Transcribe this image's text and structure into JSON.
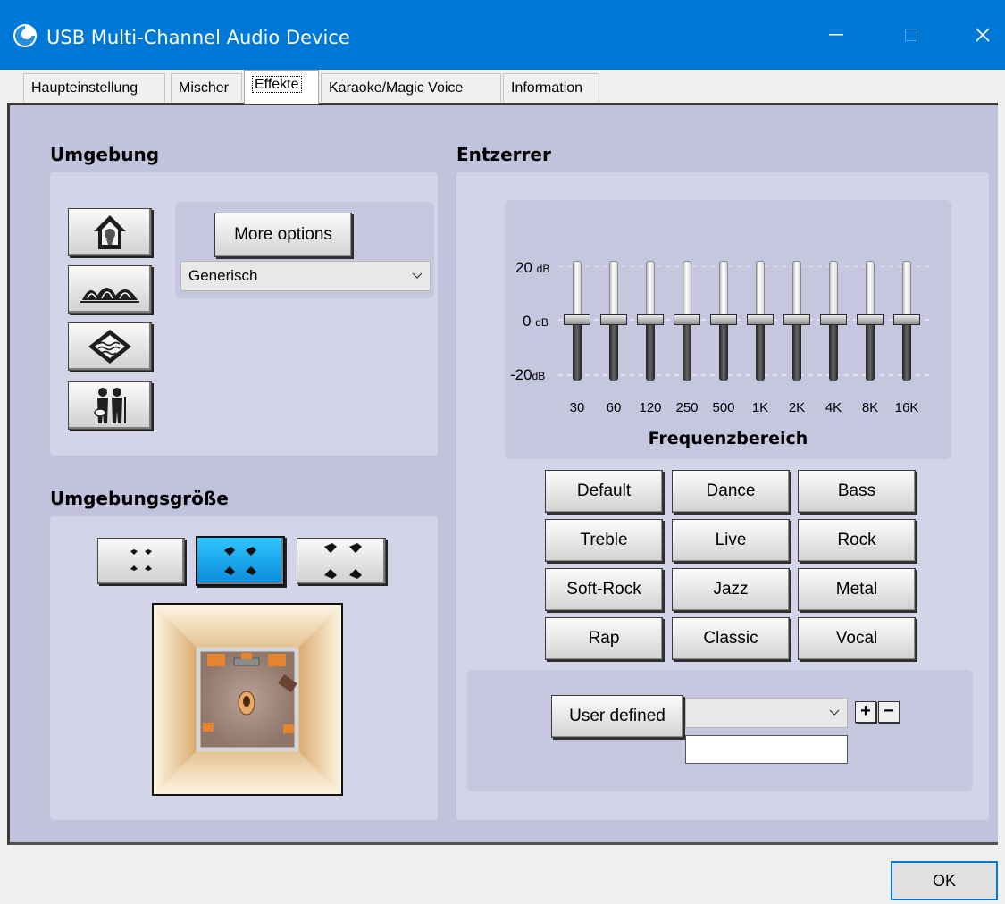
{
  "window": {
    "title": "USB Multi-Channel Audio Device",
    "controls": {
      "minimize": "—",
      "maximize": "☐",
      "close": "✕"
    }
  },
  "tabs": [
    {
      "label": "Haupteinstellung"
    },
    {
      "label": "Mischer"
    },
    {
      "label": "Effekte",
      "active": true
    },
    {
      "label": "Karaoke/Magic Voice"
    },
    {
      "label": "Information"
    }
  ],
  "environment": {
    "title": "Umgebung",
    "buttons": [
      "house-icon",
      "concert-hall-icon",
      "underwater-icon",
      "musicians-icon"
    ],
    "more_options": "More options",
    "dropdown_value": "Generisch"
  },
  "room_size": {
    "title": "Umgebungsgröße",
    "buttons": [
      {
        "name": "small-room-button",
        "active": false
      },
      {
        "name": "medium-room-button",
        "active": true
      },
      {
        "name": "large-room-button",
        "active": false
      }
    ]
  },
  "equalizer": {
    "title": "Entzerrer",
    "db_labels": {
      "top": "20",
      "mid": "0",
      "bottom": "-20",
      "unit": "dB"
    },
    "bands": [
      "30",
      "60",
      "120",
      "250",
      "500",
      "1K",
      "2K",
      "4K",
      "8K",
      "16K"
    ],
    "band_levels_db": [
      0,
      0,
      0,
      0,
      0,
      0,
      0,
      0,
      0,
      0
    ],
    "freq_label": "Frequenzbereich",
    "presets": [
      [
        "Default",
        "Dance",
        "Bass"
      ],
      [
        "Treble",
        "Live",
        "Rock"
      ],
      [
        "Soft-Rock",
        "Jazz",
        "Metal"
      ],
      [
        "Rap",
        "Classic",
        "Vocal"
      ]
    ],
    "user_defined": "User defined",
    "user_dropdown_value": "",
    "user_name_value": "",
    "add_label": "+",
    "remove_label": "−"
  },
  "ok_label": "OK"
}
